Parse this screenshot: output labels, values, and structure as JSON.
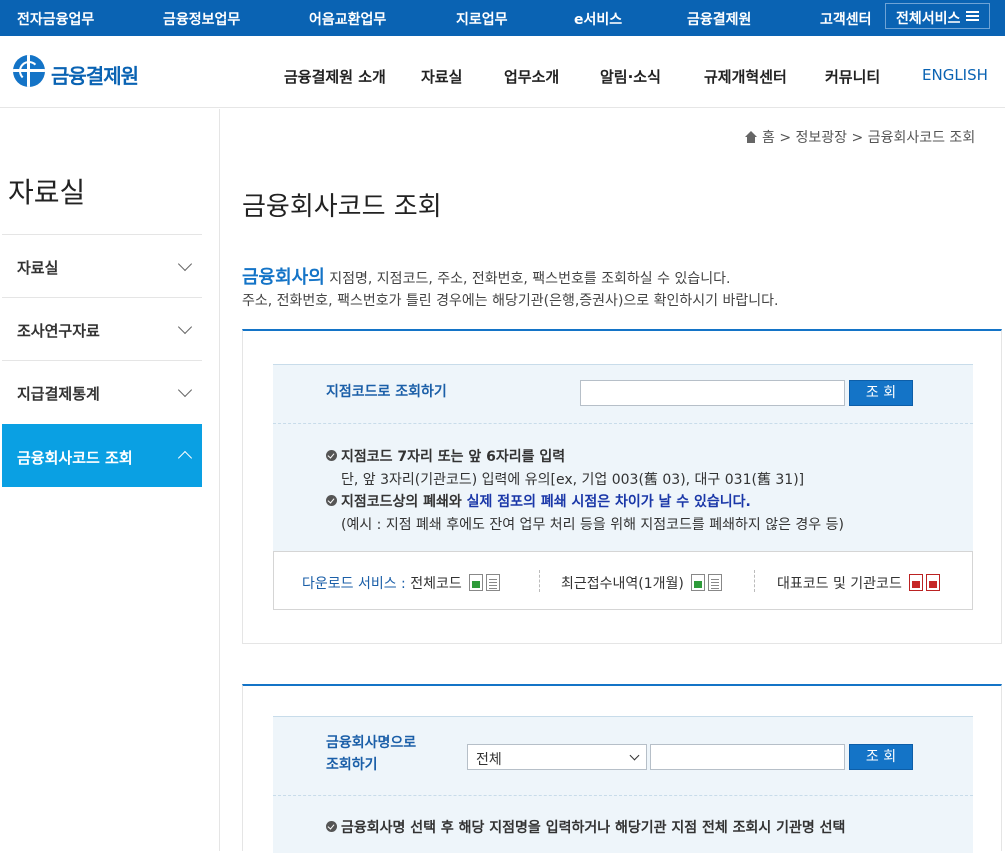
{
  "topbar": {
    "items": [
      "전자금융업무",
      "금융정보업무",
      "어음교환업무",
      "지로업무",
      "e서비스",
      "금융결제원",
      "고객센터"
    ],
    "all_services": "전체서비스"
  },
  "header": {
    "logo_text": "금융결제원",
    "nav": [
      "금융결제원 소개",
      "자료실",
      "업무소개",
      "알림·소식",
      "규제개혁센터",
      "커뮤니티",
      "ENGLISH"
    ]
  },
  "sidebar": {
    "title": "자료실",
    "items": [
      {
        "label": "자료실"
      },
      {
        "label": "조사연구자료"
      },
      {
        "label": "지급결제통계"
      },
      {
        "label": "금융회사코드 조회"
      }
    ]
  },
  "breadcrumb": {
    "home": "홈",
    "level1": "정보광장",
    "level2": "금융회사코드 조회",
    "sep": ">"
  },
  "page": {
    "title": "금융회사코드 조회",
    "intro_emphasis": "금융회사의",
    "intro_line1": " 지점명, 지점코드, 주소, 전화번호, 팩스번호를 조회하실 수 있습니다.",
    "intro_line2": "주소, 전화번호, 팩스번호가 틀린 경우에는 해당기관(은행,증권사)으로 확인하시기 바랍니다."
  },
  "branch_search": {
    "label": "지점코드로 조회하기",
    "input_value": "",
    "button": "조 회",
    "note1_title": "지점코드 7자리 또는 앞 6자리를 입력",
    "note1_detail": "단, 앞 3자리(기관코드) 입력에 유의[ex, 기업 003(舊 03), 대구 031(舊 31)]",
    "note2_prefix": "지점코드상의 폐쇄와 ",
    "note2_highlight": "실제 점포의 폐쇄 시점은 차이가 날 수 있습니다.",
    "note2_detail": "(예시 : 지점 폐쇄 후에도 잔여 업무 처리 등을 위해 지점코드를 폐쇄하지 않은 경우 등)"
  },
  "downloads": {
    "lead": "다운로드 서비스 :",
    "item1": " 전체코드",
    "item2": "최근접수내역(1개월)",
    "item3": "대표코드 및 기관코드"
  },
  "name_search": {
    "label_line1": "금융회사명으로",
    "label_line2": "조회하기",
    "select_value": "전체",
    "input_value": "",
    "button": "조 회",
    "note1": "금융회사명 선택 후 해당 지점명을 입력하거나 해당기관 지점 전체 조회시 기관명 선택"
  },
  "colors": {
    "primary": "#0a63b3",
    "accent": "#1474c7",
    "sidebar_active": "#0aa0e3",
    "panel_bg": "#eef5fa"
  }
}
